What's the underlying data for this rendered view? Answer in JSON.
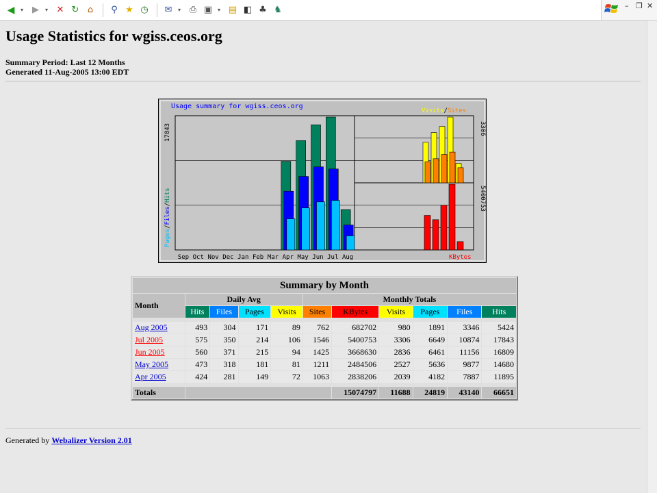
{
  "title": "Usage Statistics for wgiss.ceos.org",
  "summary_period": "Summary Period: Last 12 Months",
  "generated": "Generated 11-Aug-2005 13:00 EDT",
  "toolbar": {
    "icons": [
      "back-icon",
      "forward-icon",
      "stop-icon",
      "refresh-icon",
      "home-icon",
      "search-icon",
      "favorites-icon",
      "history-icon",
      "mail-icon",
      "print-icon",
      "edit-icon",
      "discuss-icon",
      "messenger-icon",
      "research-icon"
    ],
    "glyphs": {
      "back": "◀",
      "forward": "▶",
      "stop": "✕",
      "refresh": "↻",
      "home": "⌂",
      "search": "⚲",
      "favorites": "★",
      "history": "◷",
      "mail": "✉",
      "print": "⎙",
      "edit": "▣",
      "discuss": "▤",
      "messenger": "◧",
      "research": "♣",
      "dropdown": "▾"
    }
  },
  "window": {
    "minimize": "–",
    "restore": "❐",
    "close": "✕"
  },
  "chart_data": {
    "type": "bar",
    "title": "Usage summary for wgiss.ceos.org",
    "categories": [
      "Sep",
      "Oct",
      "Nov",
      "Dec",
      "Jan",
      "Feb",
      "Mar",
      "Apr",
      "May",
      "Jun",
      "Jul",
      "Aug"
    ],
    "main_panel": {
      "ylabel_parts": [
        "Pages",
        "/",
        "Files",
        "/",
        "Hits"
      ],
      "ymax_label": "17843",
      "ylim": [
        0,
        17843
      ],
      "series": [
        {
          "name": "Hits",
          "color": "#00805c",
          "values": [
            0,
            0,
            0,
            0,
            0,
            0,
            0,
            11895,
            14680,
            16809,
            17843,
            5424
          ]
        },
        {
          "name": "Files",
          "color": "#0000ff",
          "values": [
            0,
            0,
            0,
            0,
            0,
            0,
            0,
            7887,
            9877,
            11156,
            10874,
            3346
          ]
        },
        {
          "name": "Pages",
          "color": "#00c0ff",
          "values": [
            0,
            0,
            0,
            0,
            0,
            0,
            0,
            4182,
            5636,
            6461,
            6649,
            1891
          ]
        }
      ]
    },
    "visits_panel": {
      "legend_parts": [
        "Visits",
        "/",
        "Sites"
      ],
      "ymax_label": "3306",
      "ylim": [
        0,
        3306
      ],
      "series": [
        {
          "name": "Visits",
          "color": "#ffff00",
          "values": [
            2039,
            2527,
            2836,
            3306,
            980
          ]
        },
        {
          "name": "Sites",
          "color": "#ff8000",
          "values": [
            1063,
            1211,
            1425,
            1546,
            762
          ]
        }
      ]
    },
    "kbytes_panel": {
      "legend": "KBytes",
      "ymax_label": "5400753",
      "ylim": [
        0,
        5400753
      ],
      "series": [
        {
          "name": "KBytes",
          "color": "#ff0000",
          "values": [
            2838206,
            2484506,
            3668630,
            5400753,
            682702
          ]
        }
      ]
    },
    "colors": {
      "background": "#c0c0c0",
      "title": "#0000ff",
      "sites_text": "#ff8000",
      "visits_text": "#ffff00",
      "kbytes_text": "#ff0000",
      "hits_text": "#00805c",
      "files_text": "#0000ff",
      "pages_text": "#00c0ff"
    }
  },
  "summary": {
    "title": "Summary by Month",
    "month_label": "Month",
    "daily_avg_label": "Daily Avg",
    "monthly_totals_label": "Monthly Totals",
    "daily_cols": [
      "Hits",
      "Files",
      "Pages",
      "Visits"
    ],
    "monthly_cols": [
      "Sites",
      "KBytes",
      "Visits",
      "Pages",
      "Files",
      "Hits"
    ],
    "rows": [
      {
        "month": "Aug 2005",
        "hot": false,
        "hits": "493",
        "files": "304",
        "pages": "171",
        "visits": "89",
        "sites": "762",
        "kbytes": "682702",
        "m_visits": "980",
        "m_pages": "1891",
        "m_files": "3346",
        "m_hits": "5424"
      },
      {
        "month": "Jul 2005",
        "hot": true,
        "hits": "575",
        "files": "350",
        "pages": "214",
        "visits": "106",
        "sites": "1546",
        "kbytes": "5400753",
        "m_visits": "3306",
        "m_pages": "6649",
        "m_files": "10874",
        "m_hits": "17843"
      },
      {
        "month": "Jun 2005",
        "hot": true,
        "hits": "560",
        "files": "371",
        "pages": "215",
        "visits": "94",
        "sites": "1425",
        "kbytes": "3668630",
        "m_visits": "2836",
        "m_pages": "6461",
        "m_files": "11156",
        "m_hits": "16809"
      },
      {
        "month": "May 2005",
        "hot": false,
        "hits": "473",
        "files": "318",
        "pages": "181",
        "visits": "81",
        "sites": "1211",
        "kbytes": "2484506",
        "m_visits": "2527",
        "m_pages": "5636",
        "m_files": "9877",
        "m_hits": "14680"
      },
      {
        "month": "Apr 2005",
        "hot": false,
        "hits": "424",
        "files": "281",
        "pages": "149",
        "visits": "72",
        "sites": "1063",
        "kbytes": "2838206",
        "m_visits": "2039",
        "m_pages": "4182",
        "m_files": "7887",
        "m_hits": "11895"
      }
    ],
    "totals": {
      "label": "Totals",
      "kbytes": "15074797",
      "visits": "11688",
      "pages": "24819",
      "files": "43140",
      "hits": "66651"
    }
  },
  "footer": {
    "prefix": "Generated by ",
    "link": "Webalizer Version 2.01"
  }
}
